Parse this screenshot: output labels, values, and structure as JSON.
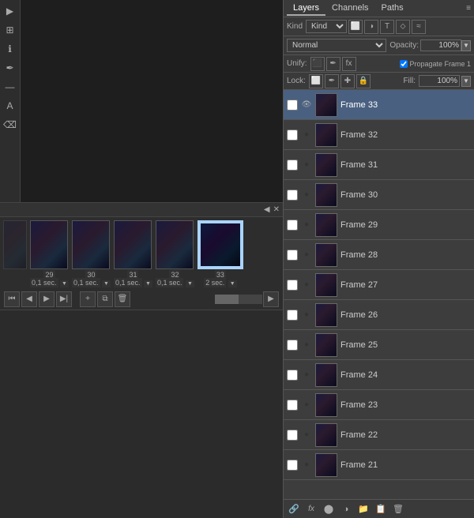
{
  "panel": {
    "tabs": [
      {
        "label": "Layers",
        "active": true
      },
      {
        "label": "Channels",
        "active": false
      },
      {
        "label": "Paths",
        "active": false
      }
    ],
    "kind_label": "Kind",
    "blend_mode": "Normal",
    "opacity_label": "Opacity:",
    "opacity_value": "100%",
    "unify_label": "Unify:",
    "propagate_label": "Propagate Frame 1",
    "lock_label": "Lock:",
    "fill_label": "Fill:",
    "fill_value": "100%"
  },
  "layers": [
    {
      "name": "Frame 33",
      "selected": true
    },
    {
      "name": "Frame 32",
      "selected": false
    },
    {
      "name": "Frame 31",
      "selected": false
    },
    {
      "name": "Frame 30",
      "selected": false
    },
    {
      "name": "Frame 29",
      "selected": false
    },
    {
      "name": "Frame 28",
      "selected": false
    },
    {
      "name": "Frame 27",
      "selected": false
    },
    {
      "name": "Frame 26",
      "selected": false
    },
    {
      "name": "Frame 25",
      "selected": false
    },
    {
      "name": "Frame 24",
      "selected": false
    },
    {
      "name": "Frame 23",
      "selected": false
    },
    {
      "name": "Frame 22",
      "selected": false
    },
    {
      "name": "Frame 21",
      "selected": false
    }
  ],
  "timeline": {
    "frames": [
      {
        "number": "29",
        "duration": "0,1 sec.",
        "selected": false
      },
      {
        "number": "30",
        "duration": "0,1 sec.",
        "selected": false
      },
      {
        "number": "31",
        "duration": "0,1 sec.",
        "selected": false
      },
      {
        "number": "32",
        "duration": "0,1 sec.",
        "selected": false
      },
      {
        "number": "33",
        "duration": "2 sec.",
        "selected": true
      }
    ]
  },
  "bottom_icons": [
    "🔗",
    "fx",
    "●",
    "📁",
    "📋",
    "🗑"
  ]
}
